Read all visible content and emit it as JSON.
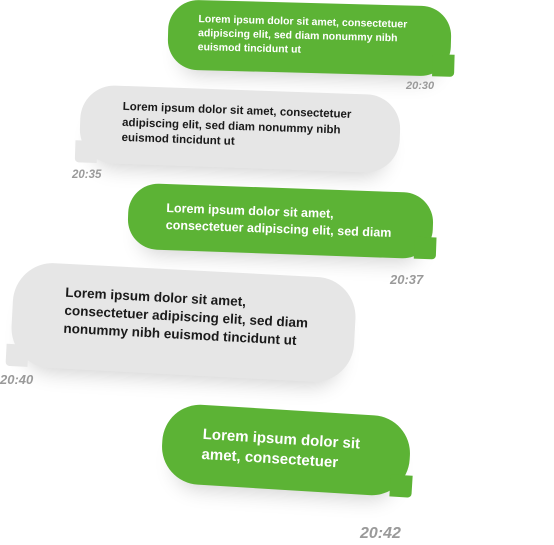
{
  "messages": [
    {
      "side": "outgoing",
      "text": "Lorem ipsum dolor sit amet, consectetuer adipiscing elit, sed diam nonummy nibh euismod tincidunt ut",
      "time": "20:30"
    },
    {
      "side": "incoming",
      "text": "Lorem ipsum dolor sit amet, consectetuer adipiscing elit, sed diam nonummy nibh euismod tincidunt ut",
      "time": "20:35"
    },
    {
      "side": "outgoing",
      "text": "Lorem ipsum dolor sit amet, consectetuer adipiscing elit, sed diam",
      "time": "20:37"
    },
    {
      "side": "incoming",
      "text": "Lorem ipsum dolor sit amet, consectetuer adipiscing elit, sed diam nonummy nibh euismod tincidunt ut",
      "time": "20:40"
    },
    {
      "side": "outgoing",
      "text": "Lorem ipsum dolor sit amet, consectetuer",
      "time": "20:42"
    }
  ],
  "colors": {
    "outgoing_bubble": "#5cb335",
    "incoming_bubble": "#e6e6e6",
    "timestamp": "#9a9a9a"
  }
}
